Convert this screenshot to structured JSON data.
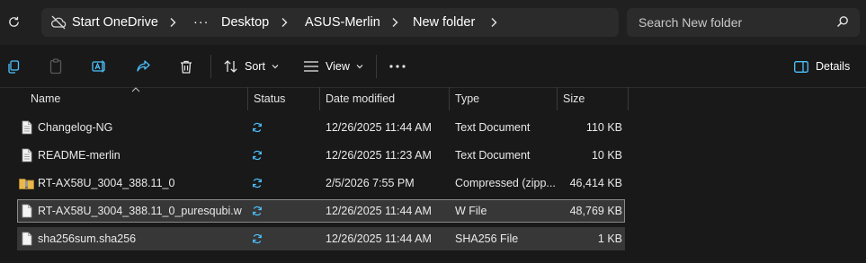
{
  "address": {
    "onedrive_label": "Start OneDrive",
    "more_label": "···",
    "crumbs": [
      "Desktop",
      "ASUS-Merlin",
      "New folder"
    ]
  },
  "search": {
    "placeholder": "Search New folder"
  },
  "toolbar": {
    "sort_label": "Sort",
    "view_label": "View",
    "more_label": "•••",
    "details_label": "Details"
  },
  "columns": {
    "name": "Name",
    "status": "Status",
    "date": "Date modified",
    "type": "Type",
    "size": "Size"
  },
  "files": [
    {
      "name": "Changelog-NG",
      "date": "12/26/2025 11:44 AM",
      "type": "Text Document",
      "size": "110 KB",
      "icon": "text-file-icon",
      "selected": false
    },
    {
      "name": "README-merlin",
      "date": "12/26/2025 11:23 AM",
      "type": "Text Document",
      "size": "10 KB",
      "icon": "text-file-icon",
      "selected": false
    },
    {
      "name": "RT-AX58U_3004_388.11_0",
      "date": "2/5/2026 7:55 PM",
      "type": "Compressed (zipp...",
      "size": "46,414 KB",
      "icon": "zip-folder-icon",
      "selected": false
    },
    {
      "name": "RT-AX58U_3004_388.11_0_puresqubi.w",
      "date": "12/26/2025 11:44 AM",
      "type": "W File",
      "size": "48,769 KB",
      "icon": "file-icon",
      "selected": true,
      "focused": true
    },
    {
      "name": "sha256sum.sha256",
      "date": "12/26/2025 11:44 AM",
      "type": "SHA256 File",
      "size": "1 KB",
      "icon": "file-icon",
      "selected": true
    }
  ],
  "colors": {
    "background": "#191919",
    "toolbar": "#202020",
    "selection": "#373737",
    "sync_status": "#4cc2ff",
    "zip": "#e8b84a"
  }
}
